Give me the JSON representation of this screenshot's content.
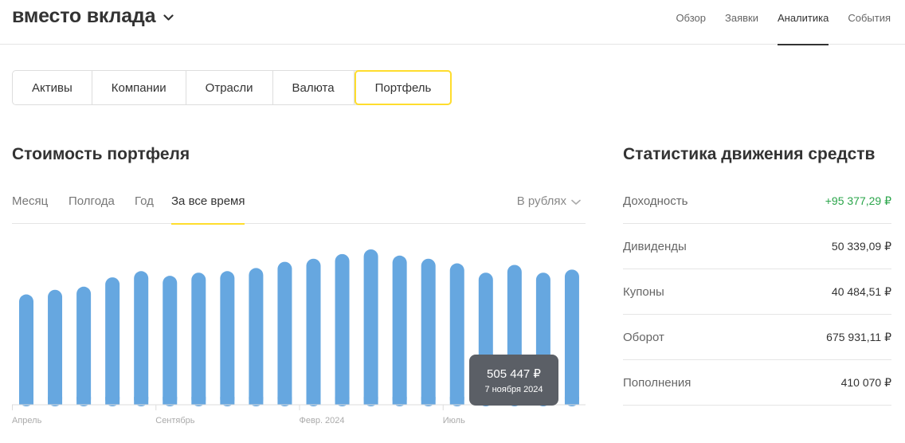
{
  "header": {
    "title": "вместо вклада",
    "nav": [
      {
        "label": "Обзор",
        "active": false
      },
      {
        "label": "Заявки",
        "active": false
      },
      {
        "label": "Аналитика",
        "active": true
      },
      {
        "label": "События",
        "active": false
      }
    ]
  },
  "segments": [
    {
      "label": "Активы",
      "active": false
    },
    {
      "label": "Компании",
      "active": false
    },
    {
      "label": "Отрасли",
      "active": false
    },
    {
      "label": "Валюта",
      "active": false
    },
    {
      "label": "Портфель",
      "active": true
    }
  ],
  "portfolio": {
    "title": "Стоимость портфеля",
    "periods": [
      {
        "label": "Месяц",
        "active": false
      },
      {
        "label": "Полгода",
        "active": false
      },
      {
        "label": "Год",
        "active": false
      },
      {
        "label": "За все время",
        "active": true
      }
    ],
    "currency": "В рублях",
    "tooltip": {
      "value": "505 447 ₽",
      "date": "7 ноября 2024"
    }
  },
  "chart_data": {
    "type": "bar",
    "color": "#66a7e0",
    "x_tick_labels": [
      "Апрель",
      "Сентябрь",
      "Февр. 2024",
      "Июль"
    ],
    "x_tick_bar_index": [
      0,
      5,
      10,
      15
    ],
    "values": [
      0.71,
      0.74,
      0.76,
      0.82,
      0.86,
      0.83,
      0.85,
      0.86,
      0.88,
      0.92,
      0.94,
      0.97,
      1.0,
      0.96,
      0.94,
      0.91,
      0.85,
      0.9,
      0.85,
      0.87
    ],
    "value_unit": "relative",
    "ylim": [
      0,
      1
    ],
    "grid": false,
    "highlight_index": 16
  },
  "stats": {
    "title": "Статистика движения средств",
    "rows": [
      {
        "label": "Доходность",
        "value": "+95 377,29 ₽",
        "positive": true
      },
      {
        "label": "Дивиденды",
        "value": "50 339,09 ₽",
        "positive": false
      },
      {
        "label": "Купоны",
        "value": "40 484,51 ₽",
        "positive": false
      },
      {
        "label": "Оборот",
        "value": "675 931,11 ₽",
        "positive": false
      },
      {
        "label": "Пополнения",
        "value": "410 070 ₽",
        "positive": false
      }
    ]
  }
}
